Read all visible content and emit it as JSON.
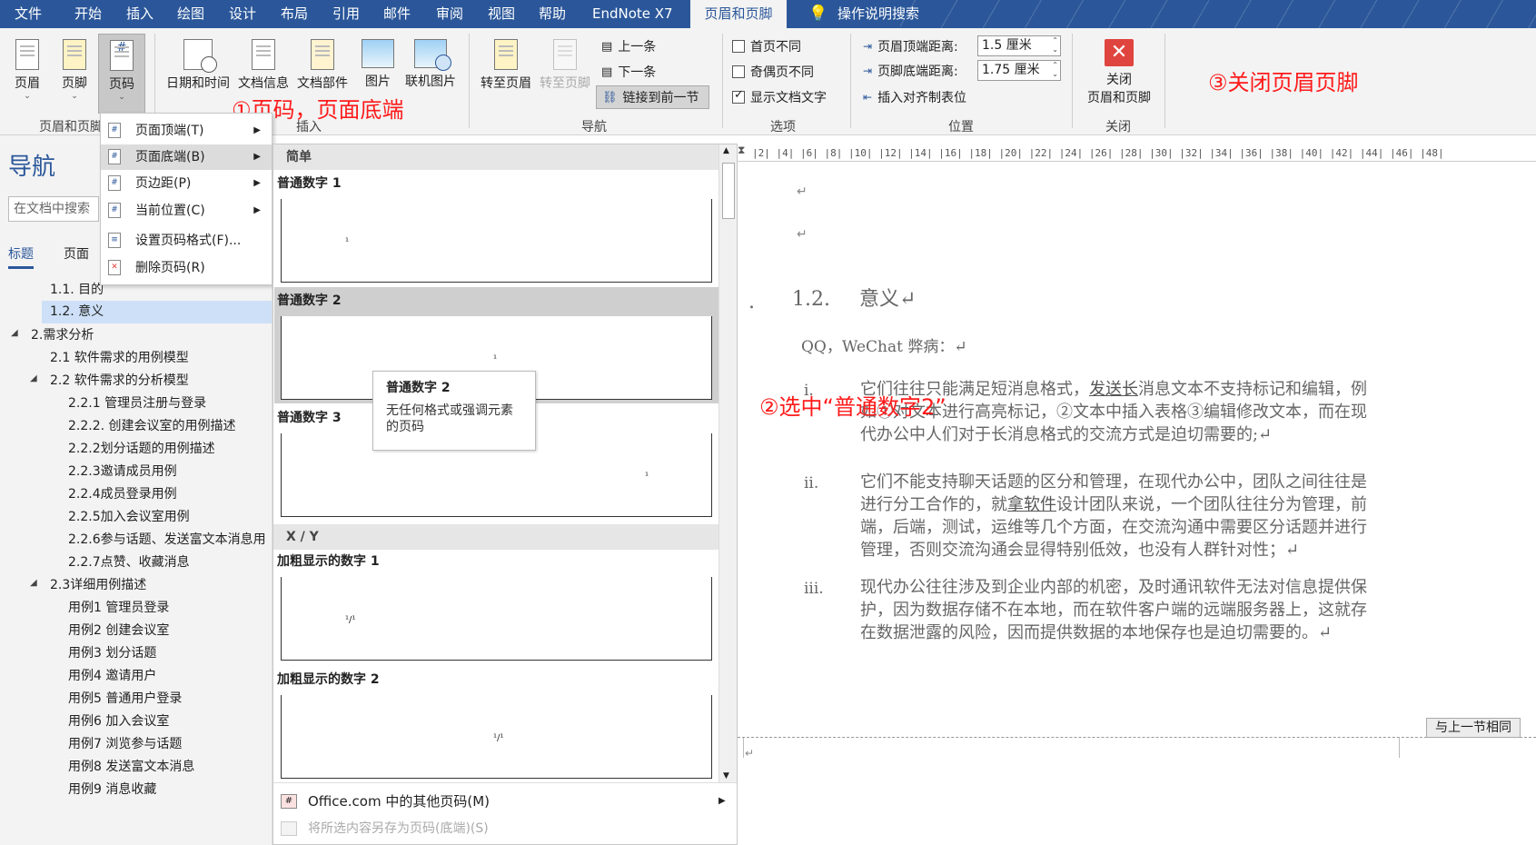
{
  "menubar": {
    "tabs": [
      "文件",
      "开始",
      "插入",
      "绘图",
      "设计",
      "布局",
      "引用",
      "邮件",
      "审阅",
      "视图",
      "帮助",
      "EndNote X7",
      "页眉和页脚"
    ],
    "search_label": "操作说明搜索",
    "bg_color": "#2b579a"
  },
  "ribbon": {
    "hf_group": {
      "header": "页眉",
      "footer": "页脚",
      "page_number": "页码",
      "label": "页眉和页脚"
    },
    "insert_group": {
      "datetime": "日期和时间",
      "docinfo": "文档信息",
      "docparts": "文档部件",
      "picture": "图片",
      "online_picture": "联机图片",
      "label": "插入"
    },
    "nav_group": {
      "goto_header": "转至页眉",
      "goto_footer": "转至页脚",
      "prev": "上一条",
      "next": "下一条",
      "link_prev": "链接到前一节",
      "label": "导航"
    },
    "options_group": {
      "diff_first": "首页不同",
      "diff_odd_even": "奇偶页不同",
      "show_doc_text": "显示文档文字",
      "label": "选项"
    },
    "position_group": {
      "header_top_label": "页眉顶端距离:",
      "header_top_value": "1.5 厘米",
      "footer_bottom_label": "页脚底端距离:",
      "footer_bottom_value": "1.75 厘米",
      "insert_align_tab": "插入对齐制表位",
      "label": "位置"
    },
    "close_group": {
      "close_line1": "关闭",
      "close_line2": "页眉和页脚",
      "label": "关闭"
    }
  },
  "annotations": {
    "a1": "①页码，页面底端",
    "a2": "②选中“普通数字2”",
    "a3": "③关闭页眉页脚",
    "color": "#ff1a1a"
  },
  "nav": {
    "title": "导航",
    "search_placeholder": "在文档中搜索",
    "tab_headings": "标题",
    "tab_pages": "页面",
    "items": [
      "1.1. 目的",
      "1.2. 意义",
      "2.需求分析",
      "2.1 软件需求的用例模型",
      "2.2 软件需求的分析模型",
      "2.2.1 管理员注册与登录",
      "2.2.2. 创建会议室的用例描述",
      "2.2.2划分话题的用例描述",
      "2.2.3邀请成员用例",
      "2.2.4成员登录用例",
      "2.2.5加入会议室用例",
      "2.2.6参与话题、发送富文本消息用",
      "2.2.7点赞、收藏消息",
      "2.3详细用例描述",
      "用例1 管理员登录",
      "用例2 创建会议室",
      "用例3 划分话题",
      "用例4 邀请用户",
      "用例5 普通用户登录",
      "用例6 加入会议室",
      "用例7 浏览参与话题",
      "用例8 发送富文本消息",
      "用例9 消息收藏"
    ]
  },
  "context_menu": {
    "items": [
      "页面顶端(T)",
      "页面底端(B)",
      "页边距(P)",
      "当前位置(C)",
      "设置页码格式(F)...",
      "删除页码(R)"
    ]
  },
  "gallery": {
    "section_simple": "简单",
    "plain1": "普通数字 1",
    "plain2": "普通数字 2",
    "plain3": "普通数字 3",
    "section_xy": "X / Y",
    "bold1": "加粗显示的数字 1",
    "bold2": "加粗显示的数字 2",
    "num_mark": "¹",
    "xy_mark": "¹/¹",
    "more": "Office.com 中的其他页码(M)",
    "save": "将所选内容另存为页码(底端)(S)"
  },
  "tooltip": {
    "title": "普通数字 2",
    "desc": "无任何格式或强调元素的页码"
  },
  "ruler": "|2| |4| |6| |8| |10| |12| |14| |16| |18| |20| |22| |24| |26| |28| |30| |32| |34| |36| |38| |40| |42| |44| |46| |48|",
  "document": {
    "para_mark": "↵",
    "heading_num": "1.2.",
    "heading_text": "意义↵",
    "intro": "QQ，WeChat 弊病：↵",
    "i_num": "i.",
    "i_pre": "它们往往只能满足短消息格式，",
    "i_link": "发送长",
    "i_post": "消息文本不支持标记和编辑，例如①对文本进行高亮标记，②文本中插入表格③编辑修改文本，而在现代办公中人们对于长消息格式的交流方式是迫切需要的;↵",
    "ii_num": "ii.",
    "ii_pre": "它们不能支持聊天话题的区分和管理，在现代办公中，团队之间往往是进行分工合作的，就",
    "ii_link": "拿软件",
    "ii_post": "设计团队来说，一个团队往往分为管理，前端，后端，测试，运维等几个方面，在交流沟通中需要区分话题并进行管理，否则交流沟通会显得特别低效，也没有人群针对性；↵",
    "iii_num": "iii.",
    "iii_text": "现代办公往往涉及到企业内部的机密，及时通讯软件无法对信息提供保护，因为数据存储不在本地，而在软件客户端的远端服务器上，这就存在数据泄露的风险，因而提供数据的本地保存也是迫切需要的。↵",
    "same_as_prev": "与上一节相同",
    "footer_mark": "↵"
  }
}
